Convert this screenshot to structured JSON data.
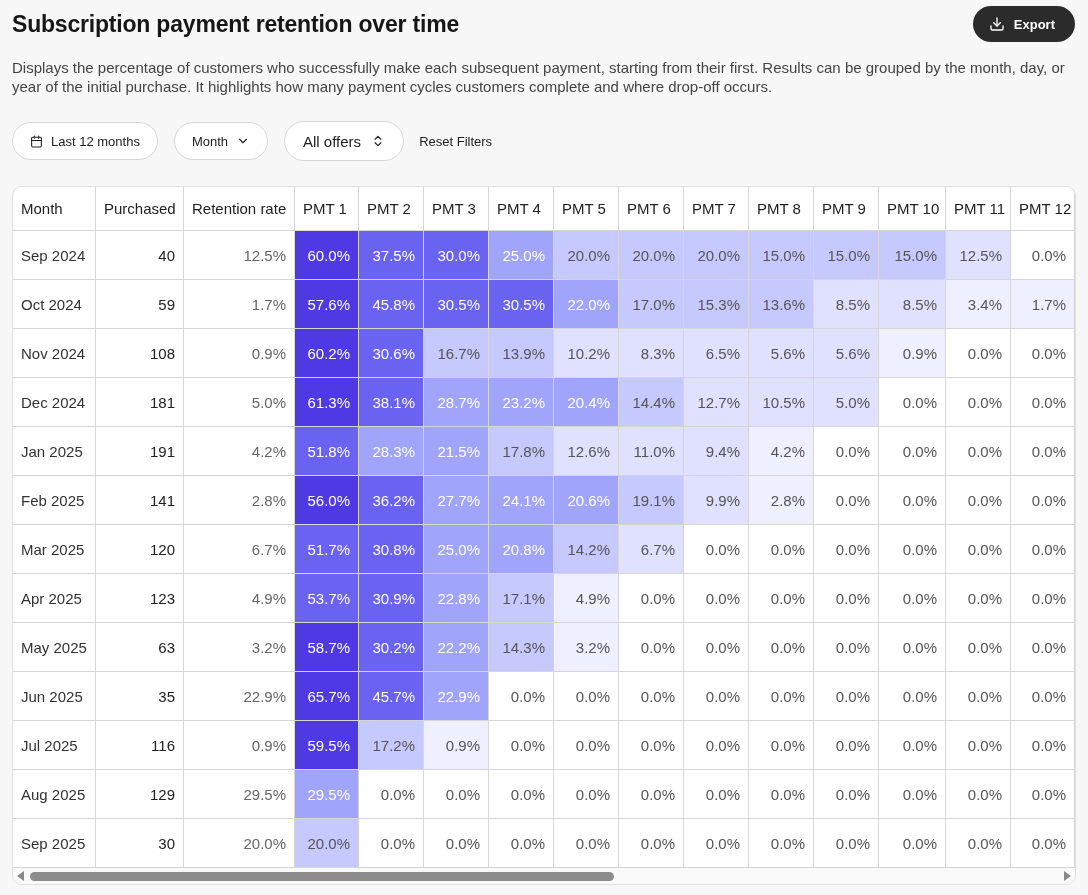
{
  "header": {
    "title": "Subscription payment retention over time",
    "export_label": "Export"
  },
  "description": "Displays the percentage of customers who successfully make each subsequent payment, starting from their first. Results can be grouped by the month, day, or year of the initial purchase. It highlights how many payment cycles customers complete and where drop-off occurs.",
  "filters": [
    {
      "kind": "date",
      "label": "Last 12 months"
    },
    {
      "kind": "dropdown",
      "label": "Month"
    },
    {
      "kind": "select",
      "label": "All offers"
    },
    {
      "kind": "link",
      "label": "Reset Filters"
    }
  ],
  "table": {
    "columns": [
      "Month",
      "Purchased",
      "Retention rate",
      "PMT 1",
      "PMT 2",
      "PMT 3",
      "PMT 4",
      "PMT 5",
      "PMT 6",
      "PMT 7",
      "PMT 8",
      "PMT 9",
      "PMT 10",
      "PMT 11",
      "PMT 12"
    ],
    "rows": [
      {
        "month": "Sep 2024",
        "purchased": "40",
        "retention_rate": "12.5%",
        "payments": [
          {
            "value": "60.0%",
            "color": "#4f39e4"
          },
          {
            "value": "37.5%",
            "color": "#6a62f1"
          },
          {
            "value": "30.0%",
            "color": "#6a62f1"
          },
          {
            "value": "25.0%",
            "color": "#a0a5fb"
          },
          {
            "value": "20.0%",
            "color": "#c6c9fd"
          },
          {
            "value": "20.0%",
            "color": "#c6c9fd"
          },
          {
            "value": "20.0%",
            "color": "#c6c9fd"
          },
          {
            "value": "15.0%",
            "color": "#c6c9fd"
          },
          {
            "value": "15.0%",
            "color": "#c6c9fd"
          },
          {
            "value": "15.0%",
            "color": "#c6c9fd"
          },
          {
            "value": "12.5%",
            "color": "#dfe1fe"
          },
          {
            "value": "0.0%",
            "color": "#ffffff"
          }
        ]
      },
      {
        "month": "Oct 2024",
        "purchased": "59",
        "retention_rate": "1.7%",
        "payments": [
          {
            "value": "57.6%",
            "color": "#4f39e4"
          },
          {
            "value": "45.8%",
            "color": "#6a62f1"
          },
          {
            "value": "30.5%",
            "color": "#6a62f1"
          },
          {
            "value": "30.5%",
            "color": "#6a62f1"
          },
          {
            "value": "22.0%",
            "color": "#a0a5fb"
          },
          {
            "value": "17.0%",
            "color": "#c6c9fd"
          },
          {
            "value": "15.3%",
            "color": "#c6c9fd"
          },
          {
            "value": "13.6%",
            "color": "#c6c9fd"
          },
          {
            "value": "8.5%",
            "color": "#dfe1fe"
          },
          {
            "value": "8.5%",
            "color": "#dfe1fe"
          },
          {
            "value": "3.4%",
            "color": "#eef0ff"
          },
          {
            "value": "1.7%",
            "color": "#eef0ff"
          }
        ]
      },
      {
        "month": "Nov 2024",
        "purchased": "108",
        "retention_rate": "0.9%",
        "payments": [
          {
            "value": "60.2%",
            "color": "#4f39e4"
          },
          {
            "value": "30.6%",
            "color": "#6a62f1"
          },
          {
            "value": "16.7%",
            "color": "#c6c9fd"
          },
          {
            "value": "13.9%",
            "color": "#c6c9fd"
          },
          {
            "value": "10.2%",
            "color": "#dfe1fe"
          },
          {
            "value": "8.3%",
            "color": "#dfe1fe"
          },
          {
            "value": "6.5%",
            "color": "#dfe1fe"
          },
          {
            "value": "5.6%",
            "color": "#dfe1fe"
          },
          {
            "value": "5.6%",
            "color": "#dfe1fe"
          },
          {
            "value": "0.9%",
            "color": "#eef0ff"
          },
          {
            "value": "0.0%",
            "color": "#ffffff"
          },
          {
            "value": "0.0%",
            "color": "#ffffff"
          }
        ]
      },
      {
        "month": "Dec 2024",
        "purchased": "181",
        "retention_rate": "5.0%",
        "payments": [
          {
            "value": "61.3%",
            "color": "#4f39e4"
          },
          {
            "value": "38.1%",
            "color": "#6a62f1"
          },
          {
            "value": "28.7%",
            "color": "#a0a5fb"
          },
          {
            "value": "23.2%",
            "color": "#a0a5fb"
          },
          {
            "value": "20.4%",
            "color": "#a0a5fb"
          },
          {
            "value": "14.4%",
            "color": "#c6c9fd"
          },
          {
            "value": "12.7%",
            "color": "#dfe1fe"
          },
          {
            "value": "10.5%",
            "color": "#dfe1fe"
          },
          {
            "value": "5.0%",
            "color": "#dfe1fe"
          },
          {
            "value": "0.0%",
            "color": "#ffffff"
          },
          {
            "value": "0.0%",
            "color": "#ffffff"
          },
          {
            "value": "0.0%",
            "color": "#ffffff"
          }
        ]
      },
      {
        "month": "Jan 2025",
        "purchased": "191",
        "retention_rate": "4.2%",
        "payments": [
          {
            "value": "51.8%",
            "color": "#6a62f1"
          },
          {
            "value": "28.3%",
            "color": "#a0a5fb"
          },
          {
            "value": "21.5%",
            "color": "#a0a5fb"
          },
          {
            "value": "17.8%",
            "color": "#c6c9fd"
          },
          {
            "value": "12.6%",
            "color": "#dfe1fe"
          },
          {
            "value": "11.0%",
            "color": "#dfe1fe"
          },
          {
            "value": "9.4%",
            "color": "#dfe1fe"
          },
          {
            "value": "4.2%",
            "color": "#eef0ff"
          },
          {
            "value": "0.0%",
            "color": "#ffffff"
          },
          {
            "value": "0.0%",
            "color": "#ffffff"
          },
          {
            "value": "0.0%",
            "color": "#ffffff"
          },
          {
            "value": "0.0%",
            "color": "#ffffff"
          }
        ]
      },
      {
        "month": "Feb 2025",
        "purchased": "141",
        "retention_rate": "2.8%",
        "payments": [
          {
            "value": "56.0%",
            "color": "#4f39e4"
          },
          {
            "value": "36.2%",
            "color": "#6a62f1"
          },
          {
            "value": "27.7%",
            "color": "#a0a5fb"
          },
          {
            "value": "24.1%",
            "color": "#a0a5fb"
          },
          {
            "value": "20.6%",
            "color": "#a0a5fb"
          },
          {
            "value": "19.1%",
            "color": "#c6c9fd"
          },
          {
            "value": "9.9%",
            "color": "#dfe1fe"
          },
          {
            "value": "2.8%",
            "color": "#eef0ff"
          },
          {
            "value": "0.0%",
            "color": "#ffffff"
          },
          {
            "value": "0.0%",
            "color": "#ffffff"
          },
          {
            "value": "0.0%",
            "color": "#ffffff"
          },
          {
            "value": "0.0%",
            "color": "#ffffff"
          }
        ]
      },
      {
        "month": "Mar 2025",
        "purchased": "120",
        "retention_rate": "6.7%",
        "payments": [
          {
            "value": "51.7%",
            "color": "#6a62f1"
          },
          {
            "value": "30.8%",
            "color": "#6a62f1"
          },
          {
            "value": "25.0%",
            "color": "#a0a5fb"
          },
          {
            "value": "20.8%",
            "color": "#a0a5fb"
          },
          {
            "value": "14.2%",
            "color": "#c6c9fd"
          },
          {
            "value": "6.7%",
            "color": "#dfe1fe"
          },
          {
            "value": "0.0%",
            "color": "#ffffff"
          },
          {
            "value": "0.0%",
            "color": "#ffffff"
          },
          {
            "value": "0.0%",
            "color": "#ffffff"
          },
          {
            "value": "0.0%",
            "color": "#ffffff"
          },
          {
            "value": "0.0%",
            "color": "#ffffff"
          },
          {
            "value": "0.0%",
            "color": "#ffffff"
          }
        ]
      },
      {
        "month": "Apr 2025",
        "purchased": "123",
        "retention_rate": "4.9%",
        "payments": [
          {
            "value": "53.7%",
            "color": "#6a62f1"
          },
          {
            "value": "30.9%",
            "color": "#6a62f1"
          },
          {
            "value": "22.8%",
            "color": "#a0a5fb"
          },
          {
            "value": "17.1%",
            "color": "#c6c9fd"
          },
          {
            "value": "4.9%",
            "color": "#eef0ff"
          },
          {
            "value": "0.0%",
            "color": "#ffffff"
          },
          {
            "value": "0.0%",
            "color": "#ffffff"
          },
          {
            "value": "0.0%",
            "color": "#ffffff"
          },
          {
            "value": "0.0%",
            "color": "#ffffff"
          },
          {
            "value": "0.0%",
            "color": "#ffffff"
          },
          {
            "value": "0.0%",
            "color": "#ffffff"
          },
          {
            "value": "0.0%",
            "color": "#ffffff"
          }
        ]
      },
      {
        "month": "May 2025",
        "purchased": "63",
        "retention_rate": "3.2%",
        "payments": [
          {
            "value": "58.7%",
            "color": "#4f39e4"
          },
          {
            "value": "30.2%",
            "color": "#6a62f1"
          },
          {
            "value": "22.2%",
            "color": "#a0a5fb"
          },
          {
            "value": "14.3%",
            "color": "#c6c9fd"
          },
          {
            "value": "3.2%",
            "color": "#eef0ff"
          },
          {
            "value": "0.0%",
            "color": "#ffffff"
          },
          {
            "value": "0.0%",
            "color": "#ffffff"
          },
          {
            "value": "0.0%",
            "color": "#ffffff"
          },
          {
            "value": "0.0%",
            "color": "#ffffff"
          },
          {
            "value": "0.0%",
            "color": "#ffffff"
          },
          {
            "value": "0.0%",
            "color": "#ffffff"
          },
          {
            "value": "0.0%",
            "color": "#ffffff"
          }
        ]
      },
      {
        "month": "Jun 2025",
        "purchased": "35",
        "retention_rate": "22.9%",
        "payments": [
          {
            "value": "65.7%",
            "color": "#4f39e4"
          },
          {
            "value": "45.7%",
            "color": "#6a62f1"
          },
          {
            "value": "22.9%",
            "color": "#a0a5fb"
          },
          {
            "value": "0.0%",
            "color": "#ffffff"
          },
          {
            "value": "0.0%",
            "color": "#ffffff"
          },
          {
            "value": "0.0%",
            "color": "#ffffff"
          },
          {
            "value": "0.0%",
            "color": "#ffffff"
          },
          {
            "value": "0.0%",
            "color": "#ffffff"
          },
          {
            "value": "0.0%",
            "color": "#ffffff"
          },
          {
            "value": "0.0%",
            "color": "#ffffff"
          },
          {
            "value": "0.0%",
            "color": "#ffffff"
          },
          {
            "value": "0.0%",
            "color": "#ffffff"
          }
        ]
      },
      {
        "month": "Jul 2025",
        "purchased": "116",
        "retention_rate": "0.9%",
        "payments": [
          {
            "value": "59.5%",
            "color": "#4f39e4"
          },
          {
            "value": "17.2%",
            "color": "#c6c9fd"
          },
          {
            "value": "0.9%",
            "color": "#eef0ff"
          },
          {
            "value": "0.0%",
            "color": "#ffffff"
          },
          {
            "value": "0.0%",
            "color": "#ffffff"
          },
          {
            "value": "0.0%",
            "color": "#ffffff"
          },
          {
            "value": "0.0%",
            "color": "#ffffff"
          },
          {
            "value": "0.0%",
            "color": "#ffffff"
          },
          {
            "value": "0.0%",
            "color": "#ffffff"
          },
          {
            "value": "0.0%",
            "color": "#ffffff"
          },
          {
            "value": "0.0%",
            "color": "#ffffff"
          },
          {
            "value": "0.0%",
            "color": "#ffffff"
          }
        ]
      },
      {
        "month": "Aug 2025",
        "purchased": "129",
        "retention_rate": "29.5%",
        "payments": [
          {
            "value": "29.5%",
            "color": "#a0a5fb"
          },
          {
            "value": "0.0%",
            "color": "#ffffff"
          },
          {
            "value": "0.0%",
            "color": "#ffffff"
          },
          {
            "value": "0.0%",
            "color": "#ffffff"
          },
          {
            "value": "0.0%",
            "color": "#ffffff"
          },
          {
            "value": "0.0%",
            "color": "#ffffff"
          },
          {
            "value": "0.0%",
            "color": "#ffffff"
          },
          {
            "value": "0.0%",
            "color": "#ffffff"
          },
          {
            "value": "0.0%",
            "color": "#ffffff"
          },
          {
            "value": "0.0%",
            "color": "#ffffff"
          },
          {
            "value": "0.0%",
            "color": "#ffffff"
          },
          {
            "value": "0.0%",
            "color": "#ffffff"
          }
        ]
      },
      {
        "month": "Sep 2025",
        "purchased": "30",
        "retention_rate": "20.0%",
        "payments": [
          {
            "value": "20.0%",
            "color": "#c6c9fd"
          },
          {
            "value": "0.0%",
            "color": "#ffffff"
          },
          {
            "value": "0.0%",
            "color": "#ffffff"
          },
          {
            "value": "0.0%",
            "color": "#ffffff"
          },
          {
            "value": "0.0%",
            "color": "#ffffff"
          },
          {
            "value": "0.0%",
            "color": "#ffffff"
          },
          {
            "value": "0.0%",
            "color": "#ffffff"
          },
          {
            "value": "0.0%",
            "color": "#ffffff"
          },
          {
            "value": "0.0%",
            "color": "#ffffff"
          },
          {
            "value": "0.0%",
            "color": "#ffffff"
          },
          {
            "value": "0.0%",
            "color": "#ffffff"
          },
          {
            "value": "0.0%",
            "color": "#ffffff"
          }
        ]
      }
    ]
  }
}
